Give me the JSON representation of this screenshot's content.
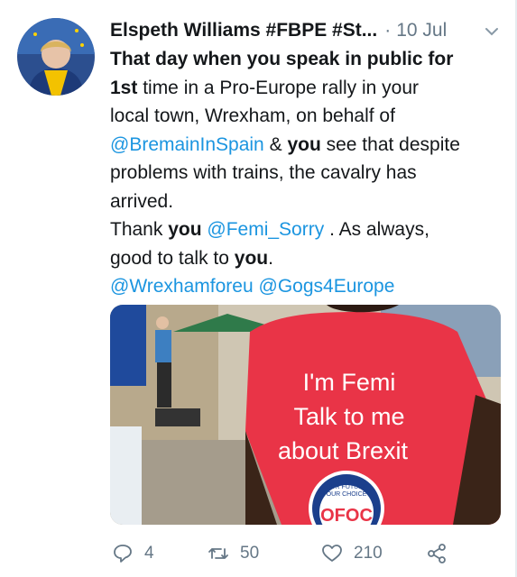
{
  "tweet": {
    "author_name": "Elspeth Williams #FBPE #St...",
    "separator": "·",
    "date": "10 Jul",
    "text": {
      "p1": "That day when you speak in public for",
      "p2": "1st",
      "p3": " time in a Pro-Europe rally in your",
      "p4": "local town, Wrexham, on behalf of",
      "mention1": "@BremainInSpain",
      "p5": " & ",
      "p6": "you",
      "p7": " see that despite",
      "p8": "problems with trains, the cavalry has",
      "p9": "arrived.",
      "p10": "Thank ",
      "p11": "you",
      "p12": " ",
      "mention2": "@Femi_Sorry",
      "p13": " . As always,",
      "p14": "good to talk to ",
      "p15": "you",
      "p16": ".",
      "mention3": "@Wrexhamforeu",
      "p17": " ",
      "mention4": "@Gogs4Europe"
    },
    "image": {
      "shirt_line1": "I'm Femi",
      "shirt_line2": "Talk to me",
      "shirt_line3": "about Brexit",
      "badge_line1": "OUR FUTURE",
      "badge_line2": "OUR CHOICE",
      "badge_logo": "OFOC"
    },
    "actions": {
      "replies": "4",
      "retweets": "50",
      "likes": "210"
    }
  },
  "icons": [
    "caret-down-icon",
    "reply-icon",
    "retweet-icon",
    "like-icon",
    "share-icon"
  ]
}
